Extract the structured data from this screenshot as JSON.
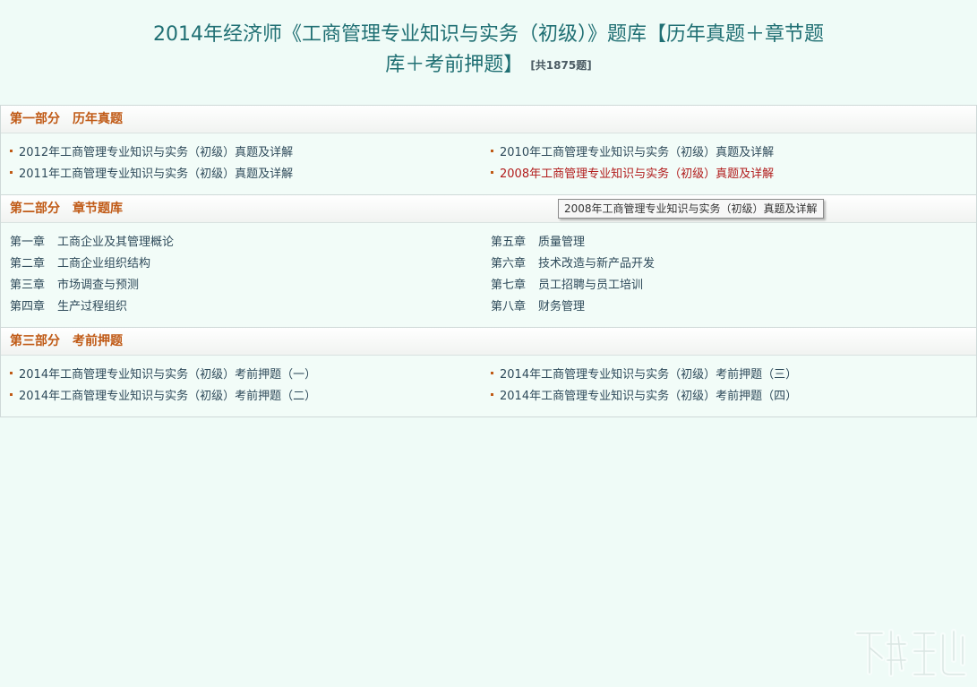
{
  "title": {
    "line1": "2014年经济师《工商管理专业知识与实务（初级）》题库【历年真题＋章节题",
    "line2": "库＋考前押题】",
    "count": "[共1875题]"
  },
  "sections": [
    {
      "part": "第一部分",
      "name": "历年真题",
      "items": [
        "2012年工商管理专业知识与实务（初级）真题及详解",
        "2010年工商管理专业知识与实务（初级）真题及详解",
        "2011年工商管理专业知识与实务（初级）真题及详解",
        "2008年工商管理专业知识与实务（初级）真题及详解"
      ]
    },
    {
      "part": "第二部分",
      "name": "章节题库",
      "chapters": [
        {
          "num": "第一章",
          "title": "工商企业及其管理概论"
        },
        {
          "num": "第五章",
          "title": "质量管理"
        },
        {
          "num": "第二章",
          "title": "工商企业组织结构"
        },
        {
          "num": "第六章",
          "title": "技术改造与新产品开发"
        },
        {
          "num": "第三章",
          "title": "市场调查与预测"
        },
        {
          "num": "第七章",
          "title": "员工招聘与员工培训"
        },
        {
          "num": "第四章",
          "title": "生产过程组织"
        },
        {
          "num": "第八章",
          "title": "财务管理"
        }
      ]
    },
    {
      "part": "第三部分",
      "name": "考前押题",
      "items": [
        "2014年工商管理专业知识与实务（初级）考前押题（一）",
        "2014年工商管理专业知识与实务（初级）考前押题（三）",
        "2014年工商管理专业知识与实务（初级）考前押题（二）",
        "2014年工商管理专业知识与实务（初级）考前押题（四）"
      ]
    }
  ],
  "tooltip": "2008年工商管理专业知识与实务（初级）真题及详解",
  "colors": {
    "background": "#effbf7",
    "title": "#1f6f73",
    "section_header": "#c05a16",
    "link": "#2e4a5a",
    "link_hover": "#b11b1b"
  },
  "icons": {
    "bullet": "square-bullet-icon",
    "watermark": "site-logo-watermark"
  }
}
